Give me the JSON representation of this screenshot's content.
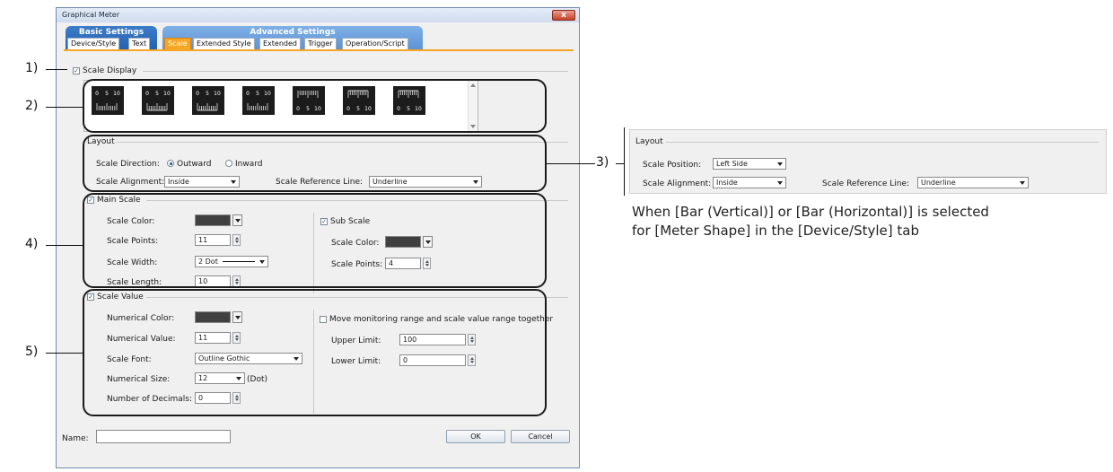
{
  "dialog": {
    "title": "Graphical Meter",
    "close_glyph": "x",
    "tab_groups": {
      "basic": "Basic Settings",
      "advanced": "Advanced Settings"
    },
    "tabs": [
      "Device/Style",
      "Text",
      "Scale",
      "Extended Style",
      "Extended",
      "Trigger",
      "Operation/Script"
    ],
    "active_tab": "Scale"
  },
  "scale_display": {
    "label": "Scale Display",
    "checked": true,
    "previews": [
      {
        "labels": [
          "0",
          "5",
          "10"
        ],
        "ticks": "top-labels-fine-bottom"
      },
      {
        "labels": [
          "0",
          "5",
          "10"
        ],
        "ticks": "top-labels-bracket"
      },
      {
        "labels": [
          "0",
          "5",
          "10"
        ],
        "ticks": "top-labels-ruler"
      },
      {
        "labels": [
          "0",
          "5",
          "10"
        ],
        "ticks": "top-labels-hanging"
      },
      {
        "labels": [
          "0",
          "5",
          "10"
        ],
        "ticks": "bottom-labels-fine"
      },
      {
        "labels": [
          "0",
          "5",
          "10"
        ],
        "ticks": "bottom-labels-bracket"
      },
      {
        "labels": [
          "0",
          "5",
          "10"
        ],
        "ticks": "bottom-labels-ruler"
      }
    ]
  },
  "layout": {
    "label": "Layout",
    "direction_label": "Scale Direction:",
    "outward_label": "Outward",
    "inward_label": "Inward",
    "direction_selected": "Outward",
    "alignment_label": "Scale Alignment:",
    "alignment_value": "Inside",
    "reference_label": "Scale Reference Line:",
    "reference_value": "Underline"
  },
  "main_scale": {
    "label": "Main Scale",
    "checked": true,
    "color_label": "Scale Color:",
    "points_label": "Scale Points:",
    "points_value": "11",
    "width_label": "Scale Width:",
    "width_value": "2 Dot",
    "length_label": "Scale Length:",
    "length_value": "10"
  },
  "sub_scale": {
    "label": "Sub Scale",
    "checked": true,
    "color_label": "Scale Color:",
    "points_label": "Scale Points:",
    "points_value": "4"
  },
  "scale_value": {
    "label": "Scale Value",
    "checked": true,
    "color_label": "Numerical Color:",
    "num_value_label": "Numerical Value:",
    "num_value": "11",
    "font_label": "Scale Font:",
    "font_value": "Outline Gothic",
    "size_label": "Numerical Size:",
    "size_value": "12",
    "size_unit": "(Dot)",
    "decimals_label": "Number of Decimals:",
    "decimals_value": "0",
    "move_label": "Move monitoring range and scale value range together",
    "move_checked": false,
    "upper_label": "Upper Limit:",
    "upper_value": "100",
    "lower_label": "Lower Limit:",
    "lower_value": "0"
  },
  "footer": {
    "name_label": "Name:",
    "name_value": "",
    "ok": "OK",
    "cancel": "Cancel"
  },
  "side_panel": {
    "label": "Layout",
    "position_label": "Scale Position:",
    "position_value": "Left Side",
    "alignment_label": "Scale Alignment:",
    "alignment_value": "Inside",
    "reference_label": "Scale Reference Line:",
    "reference_value": "Underline"
  },
  "note": {
    "line1": "When [Bar (Vertical)] or [Bar (Horizontal)] is selected",
    "line2": "for [Meter Shape] in the [Device/Style] tab"
  },
  "callouts": [
    "1)",
    "2)",
    "3)",
    "4)",
    "5)"
  ],
  "colors": {
    "accent": "#f6a623",
    "tab_blue": "#2461b0",
    "swatch": "#404040"
  }
}
